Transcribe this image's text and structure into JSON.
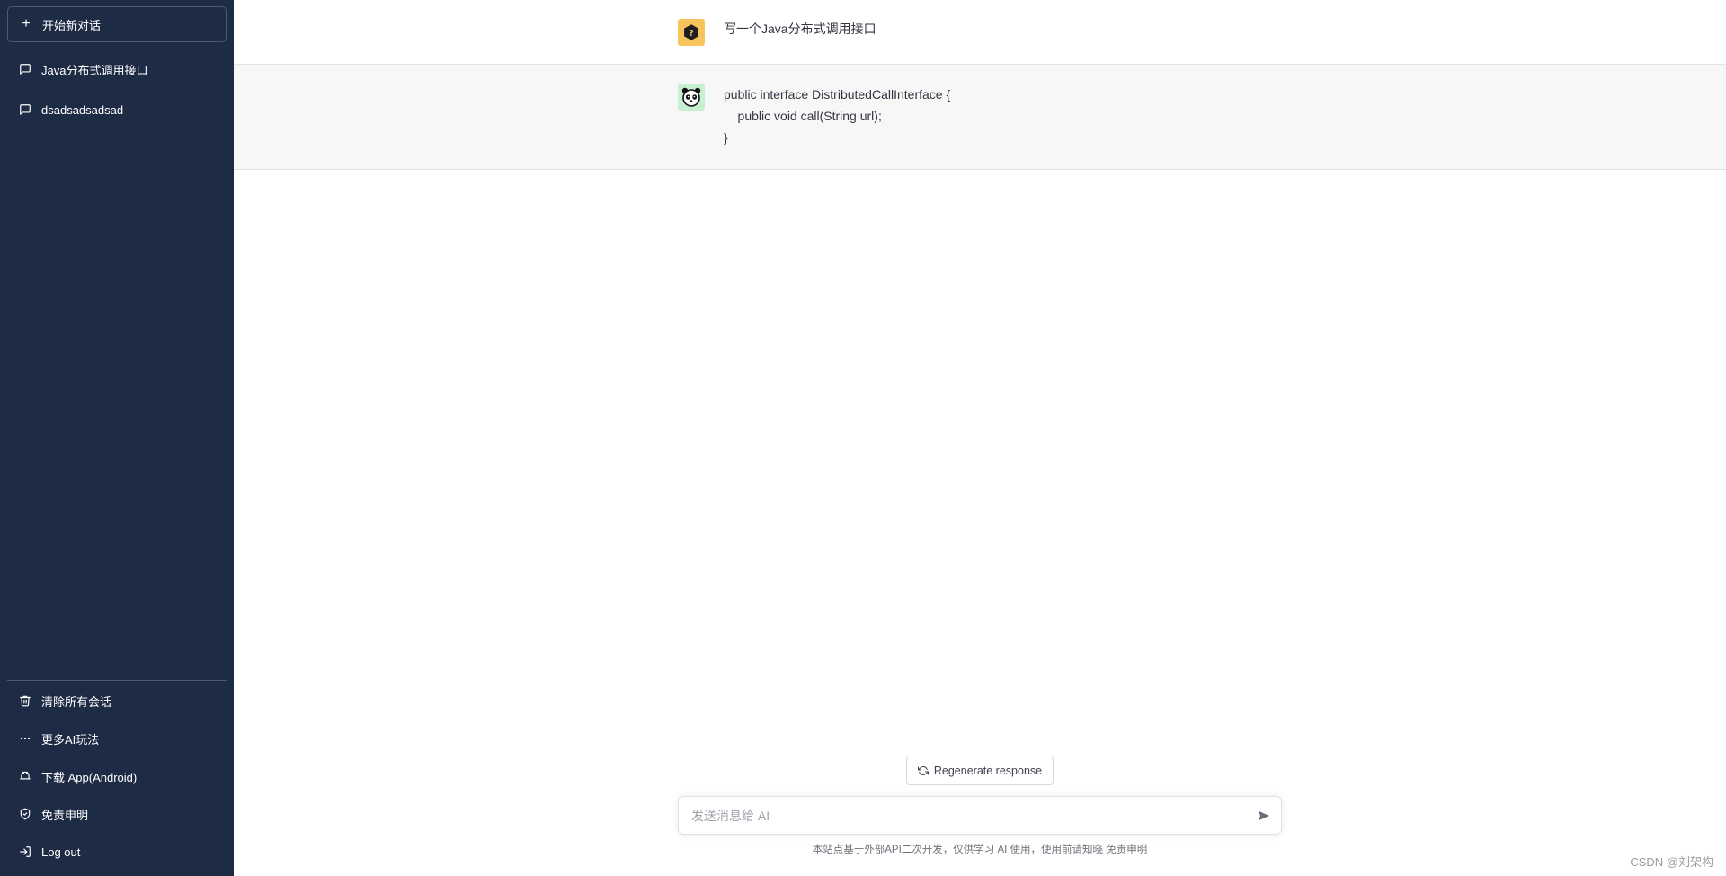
{
  "sidebar": {
    "new_chat_label": "开始新对话",
    "conversations": [
      {
        "label": "Java分布式调用接口"
      },
      {
        "label": "dsadsadsadsad"
      }
    ],
    "bottom_items": [
      {
        "label": "清除所有会话",
        "icon": "trash-icon"
      },
      {
        "label": "更多AI玩法",
        "icon": "more-dots-icon"
      },
      {
        "label": "下载 App(Android)",
        "icon": "android-icon"
      },
      {
        "label": "免责申明",
        "icon": "shield-icon"
      },
      {
        "label": "Log out",
        "icon": "logout-icon"
      }
    ],
    "colors": {
      "background": "#1e2b45"
    }
  },
  "chat": {
    "user_message": "写一个Java分布式调用接口",
    "ai_message": "public interface DistributedCallInterface {\n    public void call(String url);\n}",
    "user_avatar_color": "#f6c35c",
    "ai_avatar_color": "#c6f0cf"
  },
  "composer": {
    "regenerate_label": "Regenerate response",
    "placeholder": "发送消息给 AI",
    "footer_text": "本站点基于外部API二次开发，仅供学习 AI 使用，使用前请知晓 ",
    "footer_link": "免责申明"
  },
  "watermark": "CSDN @刘架构"
}
